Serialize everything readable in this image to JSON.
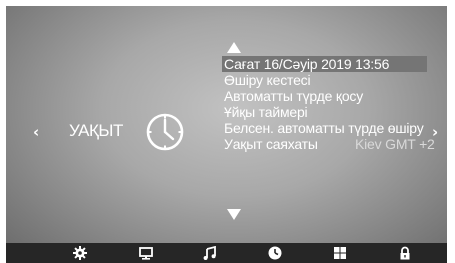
{
  "nav": {
    "left_arrow": "‹",
    "right_arrow": "›"
  },
  "section": {
    "label": "УАҚЫТ",
    "icon": "clock-icon"
  },
  "menu": {
    "items": [
      {
        "label": "Сағат   16/Сәуір  2019  13:56",
        "value": ""
      },
      {
        "label": "Өшіру кестесі",
        "value": ""
      },
      {
        "label": "Автоматты түрде қосу",
        "value": ""
      },
      {
        "label": "Ұйқы таймері",
        "value": ""
      },
      {
        "label": "Белсен. автоматты түрде өшіру",
        "value": ""
      },
      {
        "label": "Уақыт саяхаты",
        "value": "Kiev GMT +2"
      }
    ],
    "selected_index": 0
  },
  "bottom_bar": {
    "icons": [
      "gear-icon",
      "monitor-icon",
      "music-note-icon",
      "clock-icon",
      "grid-icon",
      "lock-icon"
    ],
    "active_icon": "clock-icon"
  },
  "colors": {
    "selected_row": "#757575",
    "text": "#ffffff",
    "bar": "#262626"
  }
}
